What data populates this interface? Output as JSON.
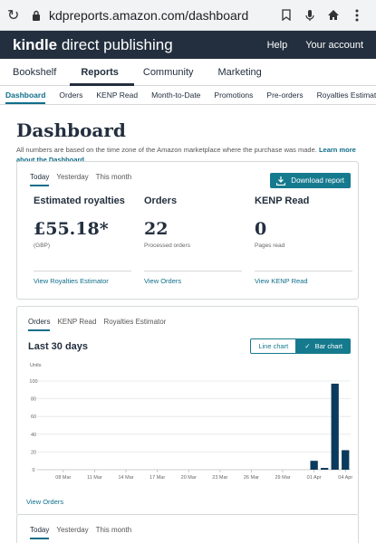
{
  "browser": {
    "url": "kdpreports.amazon.com/dashboard"
  },
  "header": {
    "logo_bold": "kindle",
    "logo_rest": " direct publishing",
    "help": "Help",
    "account": "Your account"
  },
  "main_nav": [
    "Bookshelf",
    "Reports",
    "Community",
    "Marketing"
  ],
  "main_nav_active": 1,
  "sub_nav": [
    "Dashboard",
    "Orders",
    "KENP Read",
    "Month-to-Date",
    "Promotions",
    "Pre-orders",
    "Royalties Estimator"
  ],
  "sub_nav_active": 0,
  "page": {
    "title": "Dashboard",
    "note": "All numbers are based on the time zone of the Amazon marketplace where the purchase was made.",
    "note_link": "Learn more about the Dashboard."
  },
  "summary": {
    "tabs": [
      "Today",
      "Yesterday",
      "This month"
    ],
    "active_tab": 0,
    "download_label": "Download report",
    "metrics": [
      {
        "title": "Estimated royalties",
        "value": "£55.18*",
        "sub": "(GBP)",
        "link": "View Royalties Estimator"
      },
      {
        "title": "Orders",
        "value": "22",
        "sub": "Processed orders",
        "link": "View Orders"
      },
      {
        "title": "KENP Read",
        "value": "0",
        "sub": "Pages read",
        "link": "View KENP Read"
      }
    ]
  },
  "chart_card": {
    "tabs": [
      "Orders",
      "KENP Read",
      "Royalties Estimator"
    ],
    "active_tab": 0,
    "title": "Last 30 days",
    "line_label": "Line chart",
    "bar_label": "Bar chart",
    "view_link": "View Orders"
  },
  "chart_data": {
    "type": "bar",
    "ylabel": "Units",
    "ylim": [
      0,
      100
    ],
    "yticks": [
      0,
      20,
      40,
      60,
      80,
      100
    ],
    "grid": true,
    "x_tick_labels": [
      "08 Mar",
      "11 Mar",
      "14 Mar",
      "17 Mar",
      "20 Mar",
      "23 Mar",
      "26 Mar",
      "29 Mar",
      "01 Apr",
      "04 Apr"
    ],
    "categories": [
      "06 Mar",
      "07 Mar",
      "08 Mar",
      "09 Mar",
      "10 Mar",
      "11 Mar",
      "12 Mar",
      "13 Mar",
      "14 Mar",
      "15 Mar",
      "16 Mar",
      "17 Mar",
      "18 Mar",
      "19 Mar",
      "20 Mar",
      "21 Mar",
      "22 Mar",
      "23 Mar",
      "24 Mar",
      "25 Mar",
      "26 Mar",
      "27 Mar",
      "28 Mar",
      "29 Mar",
      "30 Mar",
      "31 Mar",
      "01 Apr",
      "02 Apr",
      "03 Apr",
      "04 Apr"
    ],
    "values": [
      0,
      0,
      0,
      0,
      0,
      0,
      0,
      0,
      0,
      0,
      0,
      0,
      0,
      0,
      0,
      0,
      0,
      0,
      0,
      0,
      0,
      0,
      0,
      0,
      0,
      0,
      10,
      2,
      97,
      22
    ],
    "color": "#0b3a5c"
  },
  "bottom_card": {
    "tabs": [
      "Today",
      "Yesterday",
      "This month"
    ],
    "active_tab": 0
  }
}
